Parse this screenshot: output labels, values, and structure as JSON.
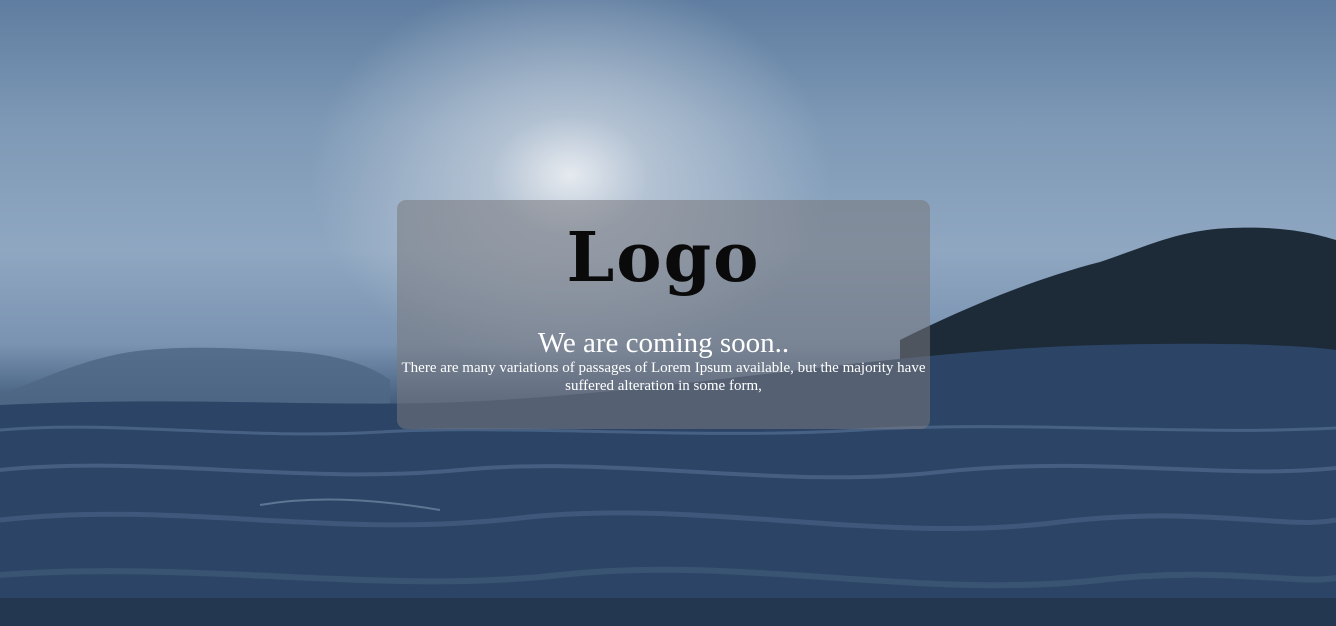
{
  "page": {
    "logo_text": "Logo",
    "heading": "We are coming soon..",
    "description": "There are many variations of passages of Lorem Ipsum available, but the majority have suffered alteration in some form,"
  },
  "colors": {
    "sky_light": "#dfe4ea",
    "sky_mid": "#7e99b6",
    "sea_dark": "#1c3350",
    "card_overlay": "rgba(120,120,125,0.55)",
    "logo_text": "#0a0a0a",
    "body_text": "#ffffff"
  }
}
